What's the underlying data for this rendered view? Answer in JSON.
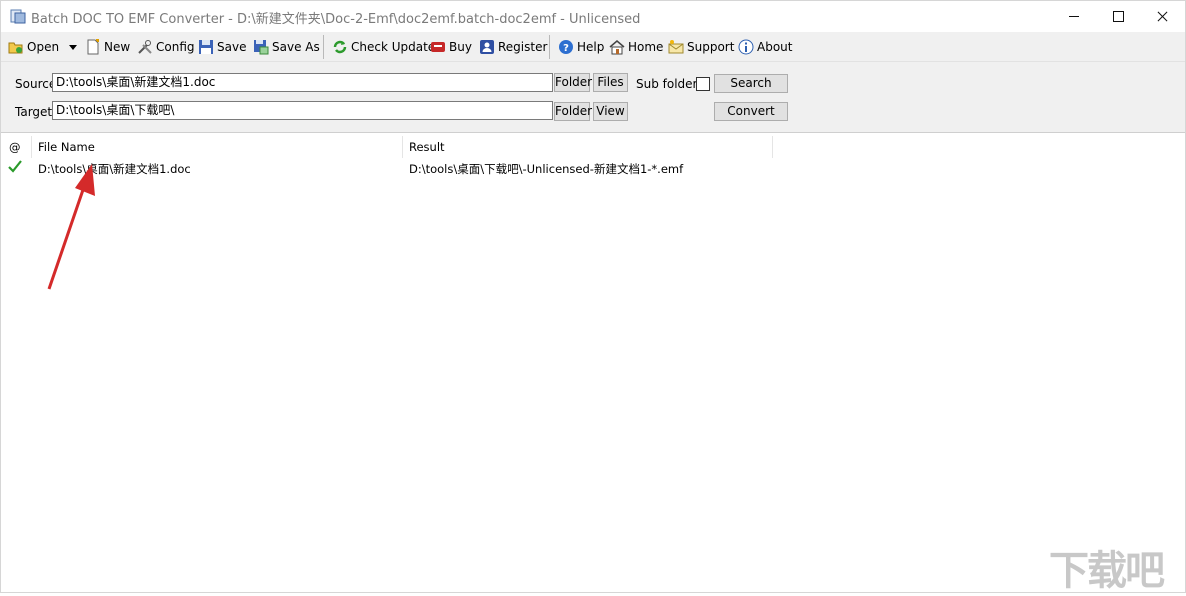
{
  "window": {
    "title": "Batch DOC TO EMF Converter - D:\\新建文件夹\\Doc-2-Emf\\doc2emf.batch-doc2emf - Unlicensed"
  },
  "toolbar": {
    "open": "Open",
    "new": "New",
    "config": "Config",
    "save": "Save",
    "save_as": "Save As",
    "check_update": "Check Update",
    "buy": "Buy",
    "register": "Register",
    "help": "Help",
    "home": "Home",
    "support": "Support",
    "about": "About"
  },
  "source": {
    "label": "Source",
    "value": "D:\\tools\\桌面\\新建文档1.doc",
    "folder_button": "Folder",
    "files_button": "Files",
    "subfolders_label": "Sub folders",
    "search_button": "Search"
  },
  "target": {
    "label": "Target",
    "value": "D:\\tools\\桌面\\下载吧\\",
    "folder_button": "Folder",
    "view_button": "View",
    "convert_button": "Convert"
  },
  "list": {
    "columns": [
      "@",
      "File Name",
      "Result"
    ],
    "rows": [
      {
        "status": "success",
        "file_name": "D:\\tools\\桌面\\新建文档1.doc",
        "result": "D:\\tools\\桌面\\下载吧\\-Unlicensed-新建文档1-*.emf"
      }
    ]
  },
  "watermark": "下载吧",
  "colors": {
    "annotation_arrow": "#d42a2a",
    "success_check": "#2a9a2a"
  }
}
